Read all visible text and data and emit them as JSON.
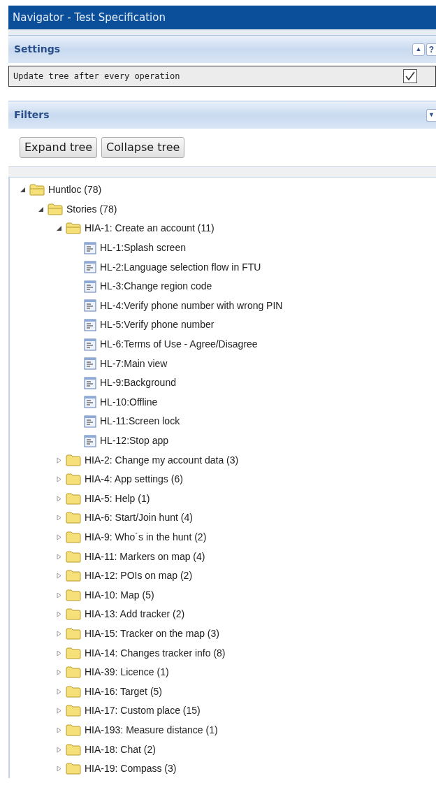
{
  "window": {
    "title": "Navigator - Test Specification"
  },
  "settings": {
    "title": "Settings",
    "collapse_button": "▲",
    "help_button": "?",
    "option": {
      "label": "Update tree after every operation",
      "checked": true
    }
  },
  "filters": {
    "title": "Filters",
    "expand_button": "▼",
    "buttons": [
      "Expand tree",
      "Collapse tree"
    ]
  },
  "tree": [
    {
      "kind": "folder",
      "label": "Huntloc (78)",
      "expanded": true,
      "children": [
        {
          "kind": "folder",
          "label": "Stories (78)",
          "expanded": true,
          "children": [
            {
              "kind": "folder",
              "label": "HIA-1: Create an account (11)",
              "expanded": true,
              "children": [
                {
                  "kind": "spec",
                  "label": "HL-1:Splash screen"
                },
                {
                  "kind": "spec",
                  "label": "HL-2:Language selection flow in FTU"
                },
                {
                  "kind": "spec",
                  "label": "HL-3:Change region code"
                },
                {
                  "kind": "spec",
                  "label": "HL-4:Verify phone number with wrong PIN"
                },
                {
                  "kind": "spec",
                  "label": "HL-5:Verify phone number"
                },
                {
                  "kind": "spec",
                  "label": "HL-6:Terms of Use - Agree/Disagree"
                },
                {
                  "kind": "spec",
                  "label": "HL-7:Main view"
                },
                {
                  "kind": "spec",
                  "label": "HL-9:Background"
                },
                {
                  "kind": "spec",
                  "label": "HL-10:Offline"
                },
                {
                  "kind": "spec",
                  "label": "HL-11:Screen lock"
                },
                {
                  "kind": "spec",
                  "label": "HL-12:Stop app"
                }
              ]
            },
            {
              "kind": "folder",
              "label": "HIA-2: Change my account data (3)",
              "expanded": false
            },
            {
              "kind": "folder",
              "label": "HIA-4: App settings (6)",
              "expanded": false
            },
            {
              "kind": "folder",
              "label": "HIA-5: Help (1)",
              "expanded": false
            },
            {
              "kind": "folder",
              "label": "HIA-6: Start/Join hunt (4)",
              "expanded": false
            },
            {
              "kind": "folder",
              "label": "HIA-9: Who´s in the hunt (2)",
              "expanded": false
            },
            {
              "kind": "folder",
              "label": "HIA-11: Markers on map (4)",
              "expanded": false
            },
            {
              "kind": "folder",
              "label": "HIA-12: POIs on map (2)",
              "expanded": false
            },
            {
              "kind": "folder",
              "label": "HIA-10: Map (5)",
              "expanded": false
            },
            {
              "kind": "folder",
              "label": "HIA-13: Add tracker (2)",
              "expanded": false
            },
            {
              "kind": "folder",
              "label": "HIA-15: Tracker on the map (3)",
              "expanded": false
            },
            {
              "kind": "folder",
              "label": "HIA-14: Changes tracker info (8)",
              "expanded": false
            },
            {
              "kind": "folder",
              "label": "HIA-39: Licence (1)",
              "expanded": false
            },
            {
              "kind": "folder",
              "label": "HIA-16: Target (5)",
              "expanded": false
            },
            {
              "kind": "folder",
              "label": "HIA-17: Custom place (15)",
              "expanded": false
            },
            {
              "kind": "folder",
              "label": "HIA-193: Measure distance (1)",
              "expanded": false
            },
            {
              "kind": "folder",
              "label": "HIA-18: Chat (2)",
              "expanded": false
            },
            {
              "kind": "folder",
              "label": "HIA-19: Compass (3)",
              "expanded": false
            }
          ]
        }
      ]
    }
  ]
}
